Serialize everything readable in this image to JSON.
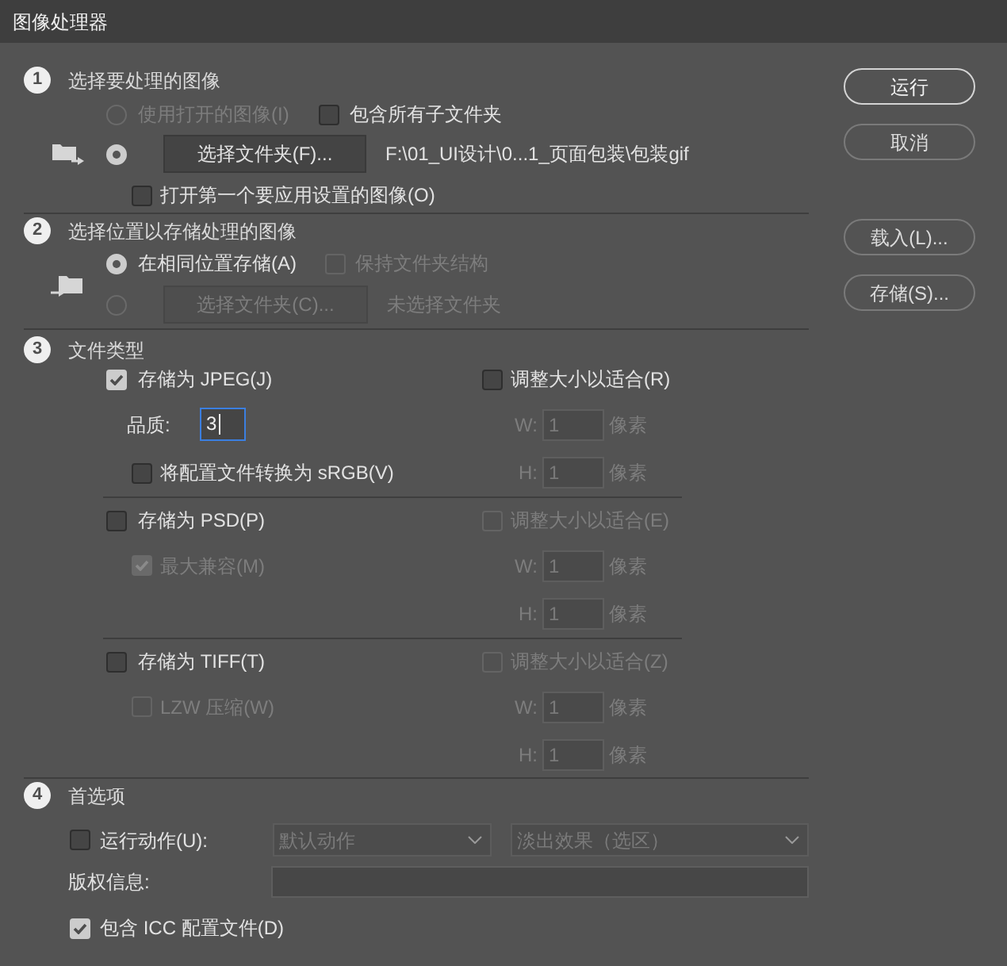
{
  "window": {
    "title": "图像处理器"
  },
  "source": {
    "number": "1",
    "title": "选择要处理的图像",
    "use_open_images": {
      "label": "使用打开的图像(I)",
      "selected": false,
      "disabled": true
    },
    "include_subfolders": {
      "label": "包含所有子文件夹",
      "checked": false,
      "disabled": false
    },
    "select_folder": {
      "selected": true,
      "button": "选择文件夹(F)...",
      "disabled": false,
      "path": "F:\\01_UI设计\\0...1_页面包装\\包装gif"
    },
    "open_first": {
      "label": "打开第一个要应用设置的图像(O)",
      "checked": false,
      "disabled": false
    }
  },
  "destination": {
    "number": "2",
    "title": "选择位置以存储处理的图像",
    "same_location": {
      "label": "在相同位置存储(A)",
      "selected": true
    },
    "keep_structure": {
      "label": "保持文件夹结构",
      "checked": false,
      "disabled": true
    },
    "select_folder": {
      "selected": false,
      "button": "选择文件夹(C)...",
      "disabled": true,
      "path": "未选择文件夹"
    }
  },
  "file_types": {
    "number": "3",
    "title": "文件类型",
    "formats": [
      {
        "label": "存储为 JPEG(J)",
        "checked": true,
        "options": [
          {
            "kind": "quality",
            "label": "品质:",
            "value": "3",
            "focused": true
          },
          {
            "kind": "checkbox",
            "label": "将配置文件转换为 sRGB(V)",
            "checked": false,
            "disabled": false
          }
        ],
        "resize": {
          "label": "调整大小以适合(R)",
          "checked": false,
          "disabled": false
        },
        "width": {
          "label": "W:",
          "value": "1",
          "unit": "像素",
          "disabled": true
        },
        "height": {
          "label": "H:",
          "value": "1",
          "unit": "像素",
          "disabled": true
        }
      },
      {
        "label": "存储为 PSD(P)",
        "checked": false,
        "options": [
          {
            "kind": "checkbox",
            "label": "最大兼容(M)",
            "checked": true,
            "disabled": true
          }
        ],
        "resize": {
          "label": "调整大小以适合(E)",
          "checked": false,
          "disabled": true
        },
        "width": {
          "label": "W:",
          "value": "1",
          "unit": "像素",
          "disabled": true
        },
        "height": {
          "label": "H:",
          "value": "1",
          "unit": "像素",
          "disabled": true
        }
      },
      {
        "label": "存储为 TIFF(T)",
        "checked": false,
        "options": [
          {
            "kind": "checkbox",
            "label": "LZW 压缩(W)",
            "checked": false,
            "disabled": true
          }
        ],
        "resize": {
          "label": "调整大小以适合(Z)",
          "checked": false,
          "disabled": true
        },
        "width": {
          "label": "W:",
          "value": "1",
          "unit": "像素",
          "disabled": true
        },
        "height": {
          "label": "H:",
          "value": "1",
          "unit": "像素",
          "disabled": true
        }
      }
    ]
  },
  "preferences": {
    "number": "4",
    "title": "首选项",
    "run_action": {
      "label": "运行动作(U):",
      "checked": false,
      "disabled": false,
      "action_set": {
        "value": "默认动作",
        "disabled": true
      },
      "action": {
        "value": "淡出效果（选区）",
        "disabled": true
      }
    },
    "copyright": {
      "label": "版权信息:"
    },
    "include_icc": {
      "label": "包含 ICC 配置文件(D)",
      "checked": true,
      "disabled": false
    }
  },
  "actions": [
    {
      "label": "运行",
      "default": true
    },
    {
      "label": "取消",
      "default": false
    }
  ],
  "presets": [
    {
      "label": "载入(L)...",
      "default": false
    },
    {
      "label": "存储(S)...",
      "default": false
    }
  ]
}
